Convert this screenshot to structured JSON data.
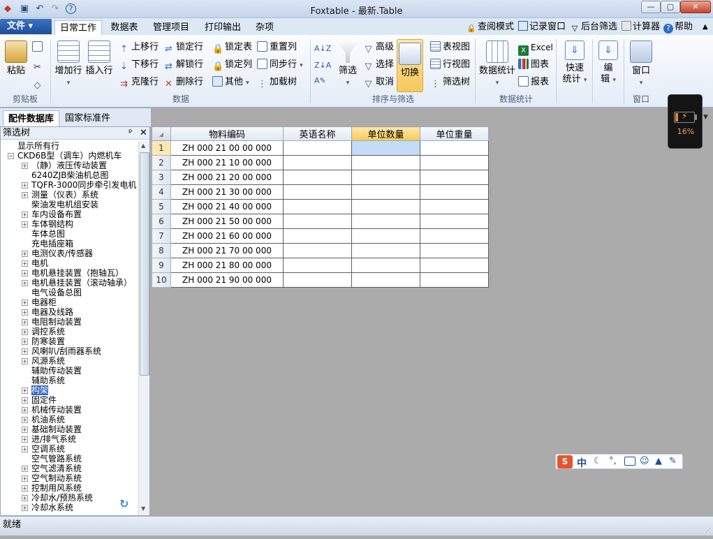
{
  "window": {
    "title": "Foxtable - 最新.Table",
    "minimize_label": "—",
    "maximize_label": "▢",
    "close_label": "✕"
  },
  "quick_access": {
    "help_label": "?"
  },
  "ribbon_tabs": {
    "file": "文件",
    "tabs": [
      "日常工作",
      "数据表",
      "管理项目",
      "打印输出",
      "杂项"
    ],
    "active": "日常工作"
  },
  "top_right_links": [
    "查阅模式",
    "记录窗口",
    "后台筛选",
    "计算器",
    "帮助"
  ],
  "groups": {
    "clipboard": {
      "label": "剪贴板",
      "paste": "粘贴"
    },
    "data": {
      "label": "数据",
      "add_row": "增加行",
      "insert_row": "插入行",
      "move_up": "上移行",
      "move_down": "下移行",
      "clone_row": "克隆行",
      "lock_row": "锁定行",
      "unlock_row": "解锁行",
      "delete_row": "删除行",
      "lock_table": "锁定表",
      "lock_col": "锁定列",
      "other": "其他",
      "reset_col": "重置列",
      "sync_col": "同步行",
      "load_tree": "加载树"
    },
    "sort_filter": {
      "label": "排序与筛选",
      "filter": "筛选",
      "advanced": "高级",
      "select": "选择",
      "cancel": "取消",
      "toggle": "切换",
      "table_view": "表视图",
      "row_view": "行视图",
      "filter_tree": "筛选树"
    },
    "stats": {
      "label": "数据统计",
      "data_stats": "数据统计",
      "excel": "Excel",
      "chart": "图表",
      "report": "报表",
      "quick_stats_1": "快速",
      "quick_stats_2": "统计",
      "edit_1": "编",
      "edit_2": "辑"
    },
    "window": {
      "label": "窗口",
      "window": "窗口"
    }
  },
  "doc_tabs": [
    "配件数据库",
    "国家标准件"
  ],
  "tree_panel": {
    "title": "筛选树",
    "pin": "ᵖ",
    "close": "✕",
    "show_all": "显示所有行",
    "root": "CKD6B型（调车）内燃机车",
    "nodes": [
      {
        "label": "（静）液压传动装置",
        "expandable": true
      },
      {
        "label": "6240ZJB柴油机总图",
        "expandable": false
      },
      {
        "label": "TQFR-3000同步牵引发电机",
        "expandable": true
      },
      {
        "label": "测量（仪表）系统",
        "expandable": true
      },
      {
        "label": "柴油发电机组安装",
        "expandable": false
      },
      {
        "label": "车内设备布置",
        "expandable": true
      },
      {
        "label": "车体钢结构",
        "expandable": true
      },
      {
        "label": "车体总图",
        "expandable": false
      },
      {
        "label": "充电插座箱",
        "expandable": false
      },
      {
        "label": "电测仪表/传感器",
        "expandable": true
      },
      {
        "label": "电机",
        "expandable": true
      },
      {
        "label": "电机悬挂装置（抱轴瓦）",
        "expandable": true
      },
      {
        "label": "电机悬挂装置（滚动轴承）",
        "expandable": true
      },
      {
        "label": "电气设备总图",
        "expandable": false
      },
      {
        "label": "电器柜",
        "expandable": true
      },
      {
        "label": "电器及线路",
        "expandable": true
      },
      {
        "label": "电阻制动装置",
        "expandable": true
      },
      {
        "label": "调控系统",
        "expandable": true
      },
      {
        "label": "防寒装置",
        "expandable": true
      },
      {
        "label": "风喇叭/刮雨器系统",
        "expandable": true
      },
      {
        "label": "风源系统",
        "expandable": true
      },
      {
        "label": "辅助传动装置",
        "expandable": false
      },
      {
        "label": "辅助系统",
        "expandable": false
      },
      {
        "label": "构架",
        "expandable": true,
        "selected": true
      },
      {
        "label": "固定件",
        "expandable": true
      },
      {
        "label": "机械传动装置",
        "expandable": true
      },
      {
        "label": "机油系统",
        "expandable": true
      },
      {
        "label": "基础制动装置",
        "expandable": true
      },
      {
        "label": "进/排气系统",
        "expandable": true
      },
      {
        "label": "空调系统",
        "expandable": true
      },
      {
        "label": "空气管路系统",
        "expandable": false
      },
      {
        "label": "空气滤清系统",
        "expandable": true
      },
      {
        "label": "空气制动系统",
        "expandable": true
      },
      {
        "label": "控制用风系统",
        "expandable": true
      },
      {
        "label": "冷却水/预热系统",
        "expandable": true
      },
      {
        "label": "冷却水系统",
        "expandable": true
      }
    ]
  },
  "table": {
    "headers": [
      "物料编码",
      "英语名称",
      "单位数量",
      "单位重量"
    ],
    "selected_header": "单位数量",
    "rows": [
      {
        "n": "1",
        "code": "ZH 000 21 00 00 000",
        "en": "",
        "qty": "",
        "wt": ""
      },
      {
        "n": "2",
        "code": "ZH 000 21 10 00 000",
        "en": "",
        "qty": "",
        "wt": ""
      },
      {
        "n": "3",
        "code": "ZH 000 21 20 00 000",
        "en": "",
        "qty": "",
        "wt": ""
      },
      {
        "n": "4",
        "code": "ZH 000 21 30 00 000",
        "en": "",
        "qty": "",
        "wt": ""
      },
      {
        "n": "5",
        "code": "ZH 000 21 40 00 000",
        "en": "",
        "qty": "",
        "wt": ""
      },
      {
        "n": "6",
        "code": "ZH 000 21 50 00 000",
        "en": "",
        "qty": "",
        "wt": ""
      },
      {
        "n": "7",
        "code": "ZH 000 21 60 00 000",
        "en": "",
        "qty": "",
        "wt": ""
      },
      {
        "n": "8",
        "code": "ZH 000 21 70 00 000",
        "en": "",
        "qty": "",
        "wt": ""
      },
      {
        "n": "9",
        "code": "ZH 000 21 80 00 000",
        "en": "",
        "qty": "",
        "wt": ""
      },
      {
        "n": "10",
        "code": "ZH 000 21 90 00 000",
        "en": "",
        "qty": "",
        "wt": ""
      }
    ]
  },
  "status": {
    "text": "就绪"
  },
  "battery": {
    "percent_label": "16%",
    "level": 0.16
  },
  "ime": {
    "mode": "中",
    "logo": "S"
  },
  "colors": {
    "accent": "#1d4d9a",
    "selection": "#3162c4",
    "header_selected": "#f6c85a"
  }
}
